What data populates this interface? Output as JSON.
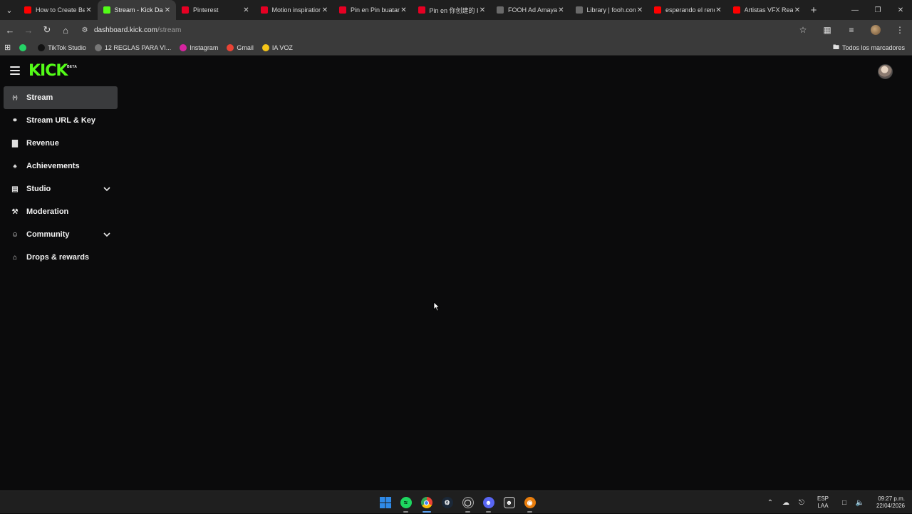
{
  "browser": {
    "tabs": [
      {
        "title": "How to Create Be",
        "color": "#ff0000",
        "active": false
      },
      {
        "title": "Stream - Kick Das",
        "color": "#53fc18",
        "active": true
      },
      {
        "title": "Pinterest",
        "color": "#e60023",
        "active": false
      },
      {
        "title": "Motion inspiration",
        "color": "#e60023",
        "active": false
      },
      {
        "title": "Pin en Pin buatan",
        "color": "#e60023",
        "active": false
      },
      {
        "title": "Pin en 你创建的 P",
        "color": "#e60023",
        "active": false
      },
      {
        "title": "FOOH Ad Amaya",
        "color": "#6a6a6a",
        "active": false
      },
      {
        "title": "Library | fooh.com",
        "color": "#6a6a6a",
        "active": false
      },
      {
        "title": "esperando el rend",
        "color": "#ff0000",
        "active": false
      },
      {
        "title": "Artistas VFX Reac",
        "color": "#ff0000",
        "active": false
      }
    ],
    "url_domain": "dashboard.kick.com",
    "url_path": "/stream",
    "bookmarks": [
      {
        "label": "",
        "icon": "whatsapp-icon",
        "color": "#25d366"
      },
      {
        "label": "TikTok Studio",
        "icon": "tiktok-icon",
        "color": "#111111"
      },
      {
        "label": "12 REGLAS PARA VI...",
        "icon": "globe-icon",
        "color": "#777777"
      },
      {
        "label": "Instagram",
        "icon": "instagram-icon",
        "color": "#d6249f"
      },
      {
        "label": "Gmail",
        "icon": "gmail-icon",
        "color": "#ea4335"
      },
      {
        "label": "IA VOZ",
        "icon": "mic-icon",
        "color": "#f5c518"
      }
    ],
    "all_bookmarks_label": "Todos los marcadores"
  },
  "app": {
    "brand": "KICK",
    "brand_badge": "BETA",
    "accent": "#53fc18",
    "nav": [
      {
        "label": "Stream",
        "icon": "broadcast-icon",
        "active": true,
        "expandable": false
      },
      {
        "label": "Stream URL & Key",
        "icon": "link-icon",
        "active": false,
        "expandable": false
      },
      {
        "label": "Revenue",
        "icon": "bar-chart-icon",
        "active": false,
        "expandable": false
      },
      {
        "label": "Achievements",
        "icon": "trophy-icon",
        "active": false,
        "expandable": false
      },
      {
        "label": "Studio",
        "icon": "studio-icon",
        "active": false,
        "expandable": true
      },
      {
        "label": "Moderation",
        "icon": "wrench-icon",
        "active": false,
        "expandable": false
      },
      {
        "label": "Community",
        "icon": "community-icon",
        "active": false,
        "expandable": true
      },
      {
        "label": "Drops & rewards",
        "icon": "gift-icon",
        "active": false,
        "expandable": false
      }
    ]
  },
  "taskbar": {
    "language": "ESP",
    "layout": "LAA",
    "time": "09:27 p.m.",
    "date": "22/04/2026"
  }
}
